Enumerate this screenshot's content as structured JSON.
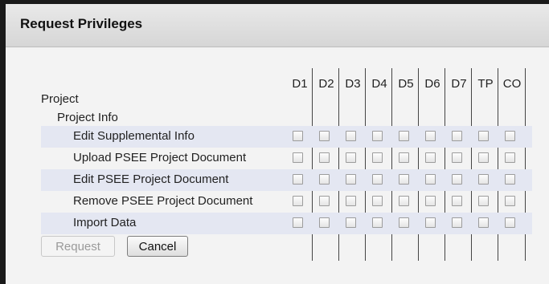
{
  "dialog": {
    "title": "Request Privileges"
  },
  "columns": [
    "D1",
    "D2",
    "D3",
    "D4",
    "D5",
    "D6",
    "D7",
    "TP",
    "CO"
  ],
  "tree": {
    "project": "Project",
    "project_info": "Project Info"
  },
  "rows": [
    {
      "label": "Edit Supplemental Info",
      "checked": [
        false,
        false,
        false,
        false,
        false,
        false,
        false,
        false,
        false
      ]
    },
    {
      "label": "Upload PSEE Project Document",
      "checked": [
        false,
        false,
        false,
        false,
        false,
        false,
        false,
        false,
        false
      ]
    },
    {
      "label": "Edit PSEE Project Document",
      "checked": [
        false,
        false,
        false,
        false,
        false,
        false,
        false,
        false,
        false
      ]
    },
    {
      "label": "Remove PSEE Project Document",
      "checked": [
        false,
        false,
        false,
        false,
        false,
        false,
        false,
        false,
        false
      ]
    },
    {
      "label": "Import Data",
      "checked": [
        false,
        false,
        false,
        false,
        false,
        false,
        false,
        false,
        false
      ]
    }
  ],
  "buttons": {
    "request": "Request",
    "cancel": "Cancel"
  }
}
